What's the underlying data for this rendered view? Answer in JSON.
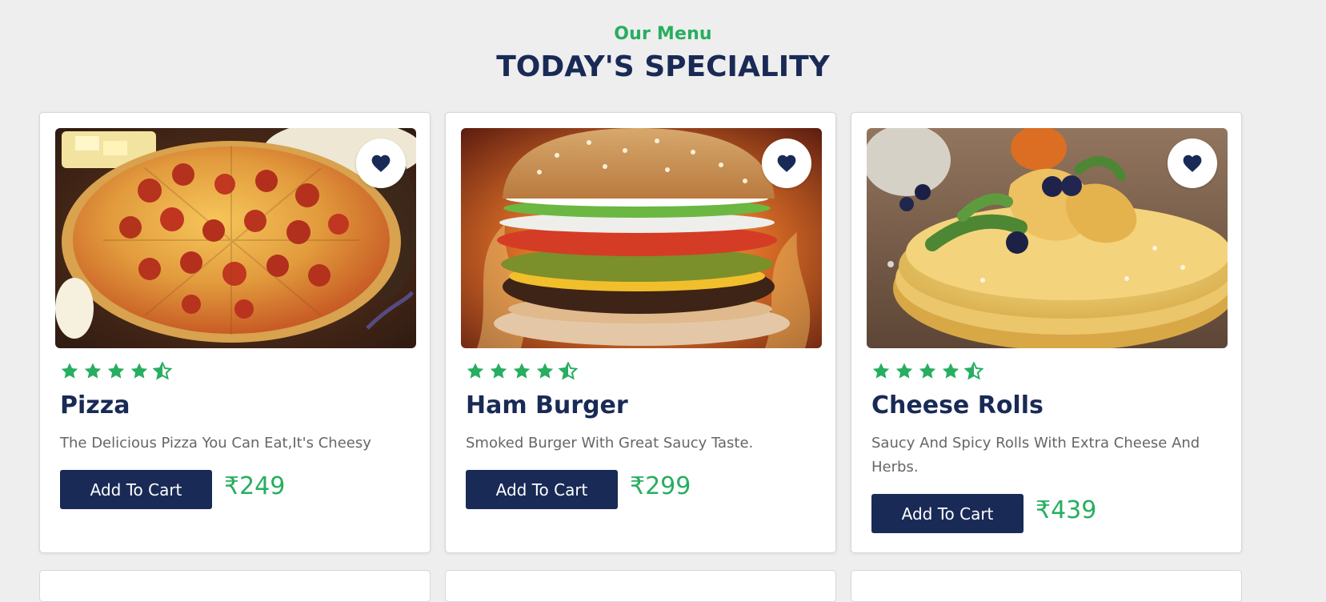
{
  "section": {
    "subtitle": "Our Menu",
    "title": "TODAY'S SPECIALITY"
  },
  "theme": {
    "accent": "#27ae60",
    "primary": "#192a56",
    "background": "#eeeeee"
  },
  "items": [
    {
      "name": "Pizza",
      "description": "The Delicious Pizza You Can Eat,It's Cheesy",
      "button_label": "Add To Cart",
      "price": "₹249",
      "rating": 4.5,
      "favorite_icon": "heart-icon"
    },
    {
      "name": "Ham Burger",
      "description": "Smoked Burger With Great Saucy Taste.",
      "button_label": "Add To Cart",
      "price": "₹299",
      "rating": 4.5,
      "favorite_icon": "heart-icon"
    },
    {
      "name": "Cheese Rolls",
      "description": "Saucy And Spicy Rolls With Extra Cheese And Herbs.",
      "button_label": "Add To Cart",
      "price": "₹439",
      "rating": 4.5,
      "favorite_icon": "heart-icon"
    }
  ]
}
